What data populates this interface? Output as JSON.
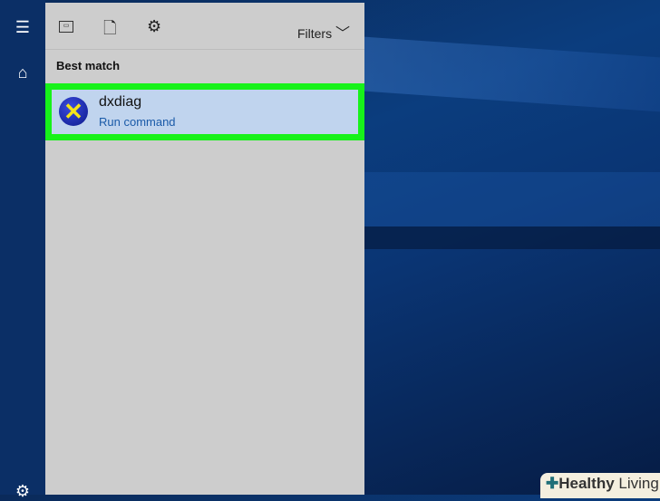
{
  "sidebar": {
    "items": [
      {
        "icon": "hamburger-icon"
      },
      {
        "icon": "home-icon"
      },
      {
        "icon": "gear-icon"
      }
    ]
  },
  "toolbar": {
    "filters_label": "Filters"
  },
  "section_heading": "Best match",
  "result": {
    "title": "dxdiag",
    "subtitle": "Run command",
    "highlight_color": "#17f21a"
  },
  "watermark": {
    "bold": "Healthy",
    "regular": " Living"
  }
}
